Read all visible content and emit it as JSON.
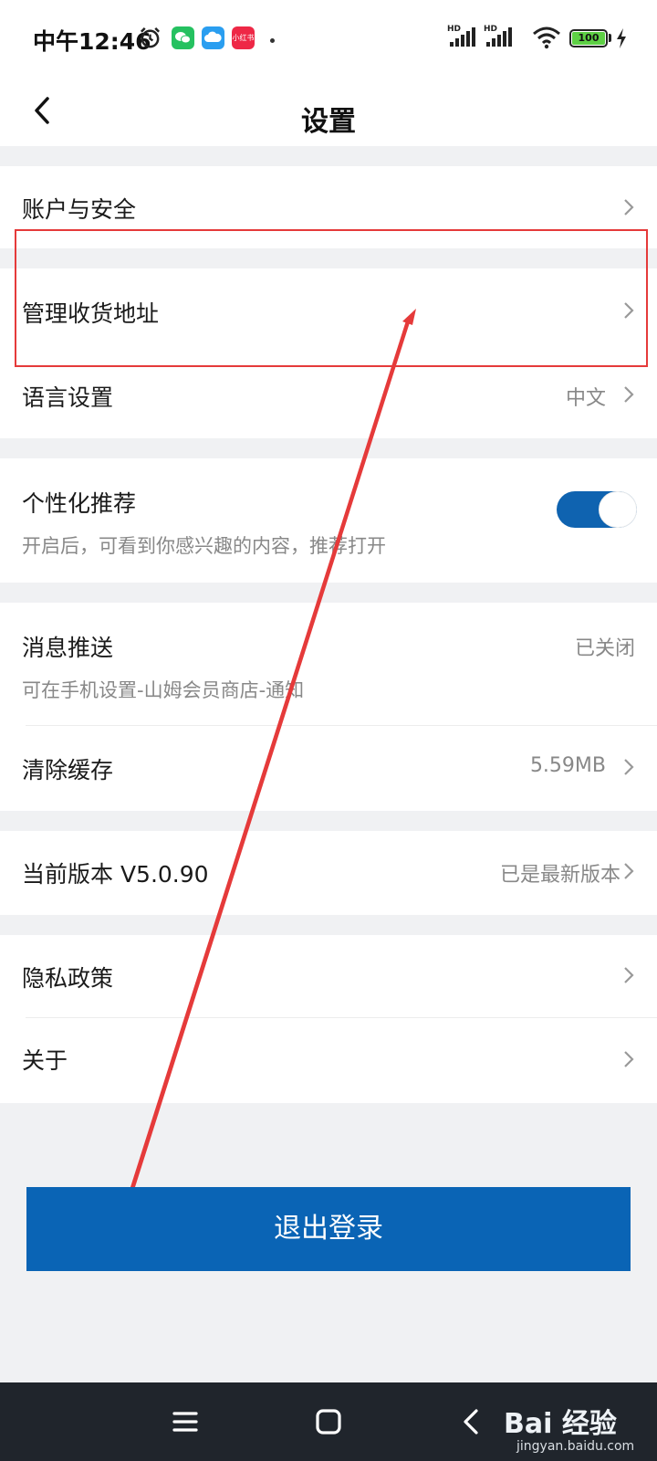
{
  "status_bar": {
    "time": "中午12:46",
    "battery": "100",
    "signal_label": "HD",
    "red_app_label": "小红书"
  },
  "header": {
    "title": "设置"
  },
  "settings": {
    "account_security": "账户与安全",
    "manage_address": "管理收货地址",
    "language": {
      "label": "语言设置",
      "value": "中文"
    },
    "personalized": {
      "label": "个性化推荐",
      "description": "开启后，可看到你感兴趣的内容，推荐打开",
      "enabled": true
    },
    "notifications": {
      "label": "消息推送",
      "description": "可在手机设置-山姆会员商店-通知",
      "value": "已关闭"
    },
    "cache": {
      "label": "清除缓存",
      "value": "5.59MB"
    },
    "version": {
      "label": "当前版本 V5.0.90",
      "value": "已是最新版本"
    },
    "privacy": "隐私政策",
    "about": "关于"
  },
  "logout_label": "退出登录",
  "watermark": {
    "logo": "Bai 经验",
    "url": "jingyan.baidu.com"
  },
  "colors": {
    "accent": "#0a64b5",
    "annotation": "#e53a3a",
    "toggle_on": "#0f63b0"
  }
}
